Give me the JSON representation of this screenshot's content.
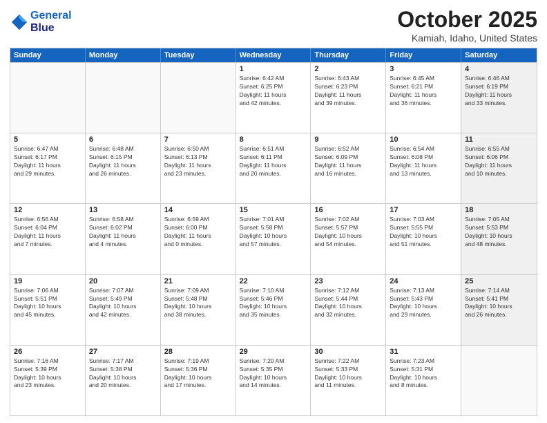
{
  "header": {
    "logo_line1": "General",
    "logo_line2": "Blue",
    "month": "October 2025",
    "location": "Kamiah, Idaho, United States"
  },
  "weekdays": [
    "Sunday",
    "Monday",
    "Tuesday",
    "Wednesday",
    "Thursday",
    "Friday",
    "Saturday"
  ],
  "rows": [
    [
      {
        "day": "",
        "info": ""
      },
      {
        "day": "",
        "info": ""
      },
      {
        "day": "",
        "info": ""
      },
      {
        "day": "1",
        "info": "Sunrise: 6:42 AM\nSunset: 6:25 PM\nDaylight: 11 hours\nand 42 minutes."
      },
      {
        "day": "2",
        "info": "Sunrise: 6:43 AM\nSunset: 6:23 PM\nDaylight: 11 hours\nand 39 minutes."
      },
      {
        "day": "3",
        "info": "Sunrise: 6:45 AM\nSunset: 6:21 PM\nDaylight: 11 hours\nand 36 minutes."
      },
      {
        "day": "4",
        "info": "Sunrise: 6:46 AM\nSunset: 6:19 PM\nDaylight: 11 hours\nand 33 minutes."
      }
    ],
    [
      {
        "day": "5",
        "info": "Sunrise: 6:47 AM\nSunset: 6:17 PM\nDaylight: 11 hours\nand 29 minutes."
      },
      {
        "day": "6",
        "info": "Sunrise: 6:48 AM\nSunset: 6:15 PM\nDaylight: 11 hours\nand 26 minutes."
      },
      {
        "day": "7",
        "info": "Sunrise: 6:50 AM\nSunset: 6:13 PM\nDaylight: 11 hours\nand 23 minutes."
      },
      {
        "day": "8",
        "info": "Sunrise: 6:51 AM\nSunset: 6:11 PM\nDaylight: 11 hours\nand 20 minutes."
      },
      {
        "day": "9",
        "info": "Sunrise: 6:52 AM\nSunset: 6:09 PM\nDaylight: 11 hours\nand 16 minutes."
      },
      {
        "day": "10",
        "info": "Sunrise: 6:54 AM\nSunset: 6:08 PM\nDaylight: 11 hours\nand 13 minutes."
      },
      {
        "day": "11",
        "info": "Sunrise: 6:55 AM\nSunset: 6:06 PM\nDaylight: 11 hours\nand 10 minutes."
      }
    ],
    [
      {
        "day": "12",
        "info": "Sunrise: 6:56 AM\nSunset: 6:04 PM\nDaylight: 11 hours\nand 7 minutes."
      },
      {
        "day": "13",
        "info": "Sunrise: 6:58 AM\nSunset: 6:02 PM\nDaylight: 11 hours\nand 4 minutes."
      },
      {
        "day": "14",
        "info": "Sunrise: 6:59 AM\nSunset: 6:00 PM\nDaylight: 11 hours\nand 0 minutes."
      },
      {
        "day": "15",
        "info": "Sunrise: 7:01 AM\nSunset: 5:58 PM\nDaylight: 10 hours\nand 57 minutes."
      },
      {
        "day": "16",
        "info": "Sunrise: 7:02 AM\nSunset: 5:57 PM\nDaylight: 10 hours\nand 54 minutes."
      },
      {
        "day": "17",
        "info": "Sunrise: 7:03 AM\nSunset: 5:55 PM\nDaylight: 10 hours\nand 51 minutes."
      },
      {
        "day": "18",
        "info": "Sunrise: 7:05 AM\nSunset: 5:53 PM\nDaylight: 10 hours\nand 48 minutes."
      }
    ],
    [
      {
        "day": "19",
        "info": "Sunrise: 7:06 AM\nSunset: 5:51 PM\nDaylight: 10 hours\nand 45 minutes."
      },
      {
        "day": "20",
        "info": "Sunrise: 7:07 AM\nSunset: 5:49 PM\nDaylight: 10 hours\nand 42 minutes."
      },
      {
        "day": "21",
        "info": "Sunrise: 7:09 AM\nSunset: 5:48 PM\nDaylight: 10 hours\nand 38 minutes."
      },
      {
        "day": "22",
        "info": "Sunrise: 7:10 AM\nSunset: 5:46 PM\nDaylight: 10 hours\nand 35 minutes."
      },
      {
        "day": "23",
        "info": "Sunrise: 7:12 AM\nSunset: 5:44 PM\nDaylight: 10 hours\nand 32 minutes."
      },
      {
        "day": "24",
        "info": "Sunrise: 7:13 AM\nSunset: 5:43 PM\nDaylight: 10 hours\nand 29 minutes."
      },
      {
        "day": "25",
        "info": "Sunrise: 7:14 AM\nSunset: 5:41 PM\nDaylight: 10 hours\nand 26 minutes."
      }
    ],
    [
      {
        "day": "26",
        "info": "Sunrise: 7:16 AM\nSunset: 5:39 PM\nDaylight: 10 hours\nand 23 minutes."
      },
      {
        "day": "27",
        "info": "Sunrise: 7:17 AM\nSunset: 5:38 PM\nDaylight: 10 hours\nand 20 minutes."
      },
      {
        "day": "28",
        "info": "Sunrise: 7:19 AM\nSunset: 5:36 PM\nDaylight: 10 hours\nand 17 minutes."
      },
      {
        "day": "29",
        "info": "Sunrise: 7:20 AM\nSunset: 5:35 PM\nDaylight: 10 hours\nand 14 minutes."
      },
      {
        "day": "30",
        "info": "Sunrise: 7:22 AM\nSunset: 5:33 PM\nDaylight: 10 hours\nand 11 minutes."
      },
      {
        "day": "31",
        "info": "Sunrise: 7:23 AM\nSunset: 5:31 PM\nDaylight: 10 hours\nand 8 minutes."
      },
      {
        "day": "",
        "info": ""
      }
    ]
  ]
}
